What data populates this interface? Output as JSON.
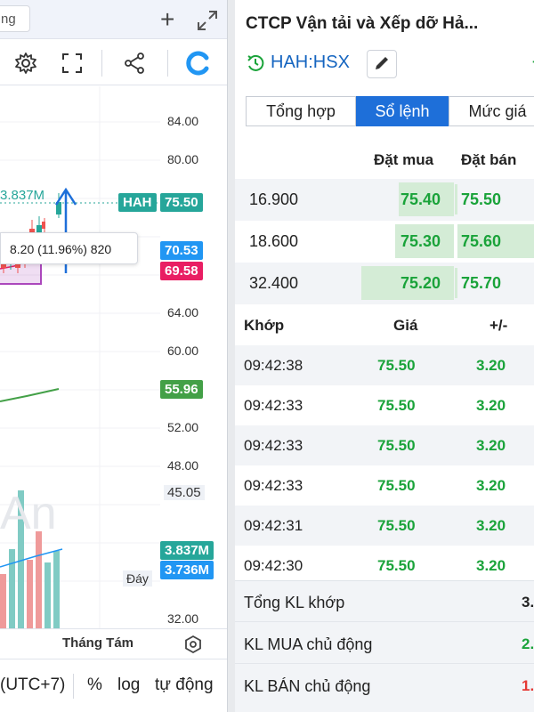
{
  "chart": {
    "tab_label": "ng",
    "volume_readout": "3.837M",
    "hint": "8.20 (11.96%) 820",
    "watermark": "An",
    "price_axis": [
      "84.00",
      "80.00",
      "64.00",
      "60.00",
      "52.00",
      "48.00",
      "32.00"
    ],
    "symbol_tag": "HAH",
    "last_price_tag": "75.50",
    "ma1_tag": "70.53",
    "ma2_tag": "69.58",
    "ma_long_tag": "55.96",
    "low_label": "Đáy",
    "low_value": "45.05",
    "vol_tag1": "3.837M",
    "vol_tag2": "3.736M",
    "month_label": "Tháng Tám",
    "bottom": {
      "timezone": "(UTC+7)",
      "percent": "%",
      "log": "log",
      "auto": "tự động"
    },
    "colors": {
      "up": "#26a69a",
      "down": "#ef5350",
      "ma_blue": "#2196f3",
      "ma_pink": "#e91e63",
      "ma_green": "#43a047"
    }
  },
  "panel": {
    "company_name": "CTCP Vận tải và Xếp dỡ Hả...",
    "ticker": "HAH:HSX",
    "change_text": "+",
    "tabs": [
      {
        "label": "Tổng hợp",
        "active": false
      },
      {
        "label": "Sổ lệnh",
        "active": true
      },
      {
        "label": "Mức giá",
        "active": false
      }
    ]
  },
  "orderbook": {
    "header_bid": "Đặt mua",
    "header_ask": "Đặt bán",
    "rows": [
      {
        "volume": "16.900",
        "bid": "75.40",
        "ask": "75.50"
      },
      {
        "volume": "18.600",
        "bid": "75.30",
        "ask": "75.60"
      },
      {
        "volume": "32.400",
        "bid": "75.20",
        "ask": "75.70"
      }
    ]
  },
  "trades": {
    "header_time": "Khớp",
    "header_price": "Giá",
    "header_change": "+/-",
    "rows": [
      {
        "time": "09:42:38",
        "price": "75.50",
        "change": "3.20"
      },
      {
        "time": "09:42:33",
        "price": "75.50",
        "change": "3.20"
      },
      {
        "time": "09:42:33",
        "price": "75.50",
        "change": "3.20"
      },
      {
        "time": "09:42:33",
        "price": "75.50",
        "change": "3.20"
      },
      {
        "time": "09:42:31",
        "price": "75.50",
        "change": "3.20"
      },
      {
        "time": "09:42:30",
        "price": "75.50",
        "change": "3.20"
      }
    ]
  },
  "summary": [
    {
      "label": "Tổng KL khớp",
      "value": "3.",
      "color": "#222222"
    },
    {
      "label": "KL MUA chủ động",
      "value": "2.",
      "color": "#1aa33a"
    },
    {
      "label": "KL BÁN chủ động",
      "value": "1.",
      "color": "#e53935"
    }
  ]
}
